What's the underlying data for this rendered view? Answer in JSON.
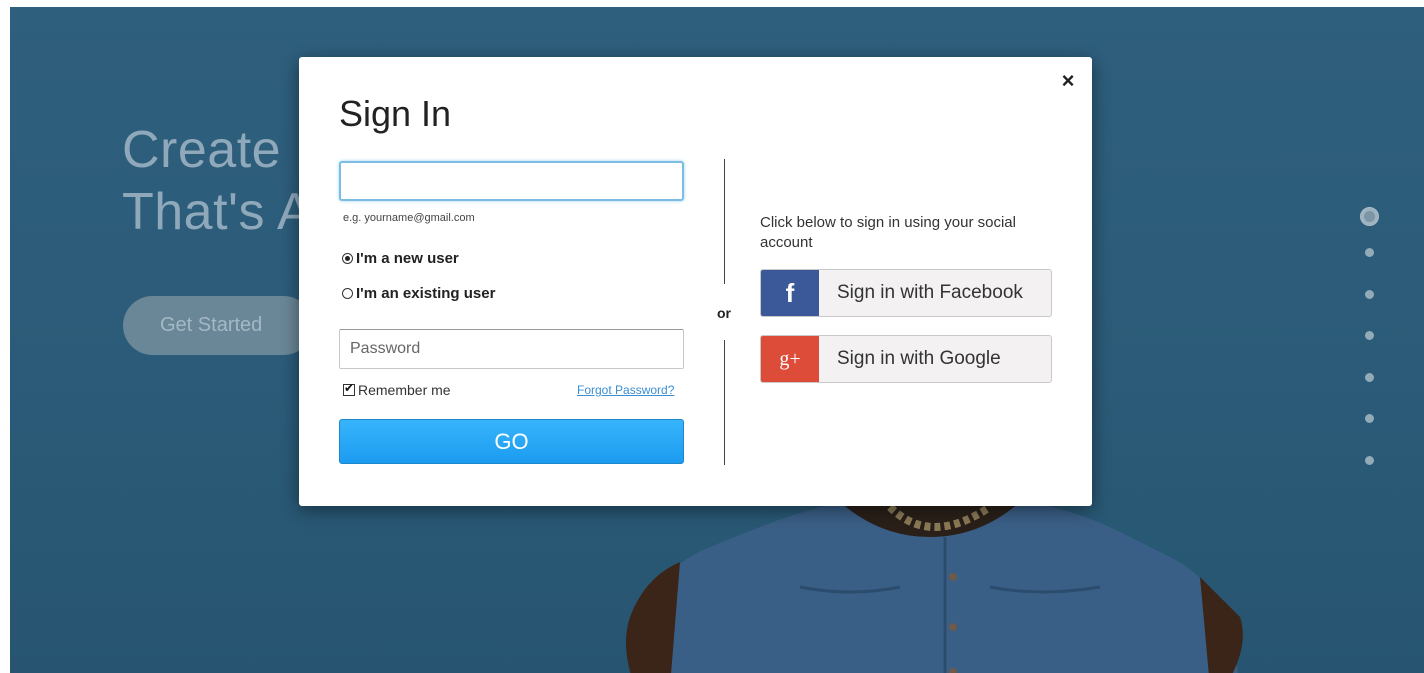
{
  "hero": {
    "headline": "Create\nThat's A",
    "cta_label": "Get Started",
    "slide_dots": [
      {
        "active": true
      },
      {
        "active": false
      },
      {
        "active": false
      },
      {
        "active": false
      },
      {
        "active": false
      },
      {
        "active": false
      },
      {
        "active": false
      }
    ]
  },
  "modal": {
    "title": "Sign In",
    "close_label": "×",
    "email": {
      "value": "",
      "placeholder": "",
      "hint": "e.g. yourname@gmail.com"
    },
    "user_type": {
      "options": [
        "I'm a new user",
        "I'm an existing user"
      ],
      "selected": "I'm a new user"
    },
    "password": {
      "value": "",
      "placeholder": "Password"
    },
    "remember_me": {
      "label": "Remember me",
      "checked": true
    },
    "forgot_password": "Forgot Password?",
    "submit_label": "GO",
    "divider_label": "or",
    "social": {
      "prompt": "Click below to sign in using your social account",
      "facebook": {
        "icon": "facebook-icon",
        "glyph": "f",
        "label": "Sign in with Facebook",
        "color": "#3b5998"
      },
      "google": {
        "icon": "google-plus-icon",
        "glyph": "g+",
        "label": "Sign in with Google",
        "color": "#dd4b39"
      }
    }
  },
  "colors": {
    "hero_background": "#2d5d7a",
    "primary_button": "#1c9cf0"
  }
}
